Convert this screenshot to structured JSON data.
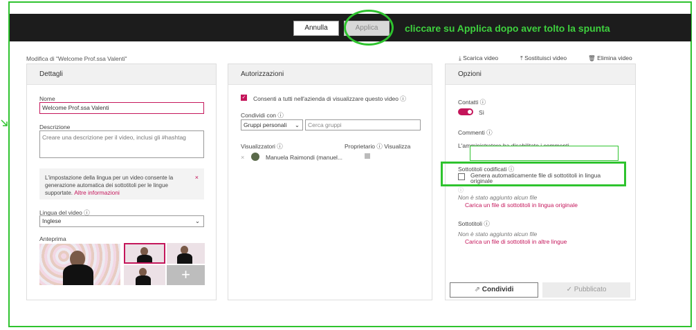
{
  "toolbar": {
    "cancel_label": "Annulla",
    "apply_label": "Applica"
  },
  "annotation": "cliccare su Applica dopo aver tolto la spunta",
  "header": {
    "title": "Modifica di \"Welcome Prof.ssa Valenti\"",
    "download": "Scarica video",
    "replace": "Sostituisci video",
    "delete": "Elimina video"
  },
  "details": {
    "title": "Dettagli",
    "name_label": "Nome",
    "name_value": "Welcome Prof.ssa Valenti",
    "desc_label": "Descrizione",
    "desc_placeholder": "Creare una descrizione per il video, inclusi gli #hashtag",
    "info_text": "L'impostazione della lingua per un video consente la generazione automatica dei sottotitoli per le lingue supportate.",
    "info_link": "Altre informazioni",
    "lang_label": "Lingua del video",
    "lang_value": "Inglese",
    "preview_label": "Anteprima"
  },
  "perms": {
    "title": "Autorizzazioni",
    "allow_all": "Consenti a tutti nell'azienda di visualizzare questo video",
    "share_label": "Condividi con",
    "share_select": "Gruppi personali",
    "search_placeholder": "Cerca gruppi",
    "viewers_label": "Visualizzatori",
    "owner_label": "Proprietario",
    "view_label": "Visualizza",
    "person_name": "Manuela Raimondi (manuel..."
  },
  "options": {
    "title": "Opzioni",
    "contacts_label": "Contatti",
    "contacts_value": "Sì",
    "comments_label": "Commenti",
    "comments_text": "L'amministratore ha disabilitato i commenti",
    "subs_coded_label": "Sottotitoli codificati",
    "auto_subs": "Genera automaticamente file di sottotitoli in lingua originale",
    "none_added_1": "Non è stato aggiunto alcun file",
    "upload_original": "Carica un file di sottotitoli in lingua originale",
    "subs_label": "Sottotitoli",
    "none_added_2": "Non è stato aggiunto alcun file",
    "upload_other": "Carica un file di sottotitoli in altre lingue",
    "share_btn": "Condividi",
    "publish_btn": "Pubblicato"
  },
  "colors": {
    "accent": "#c4155a",
    "annotation": "#2ec32e",
    "topbar": "#1c1c1c"
  }
}
